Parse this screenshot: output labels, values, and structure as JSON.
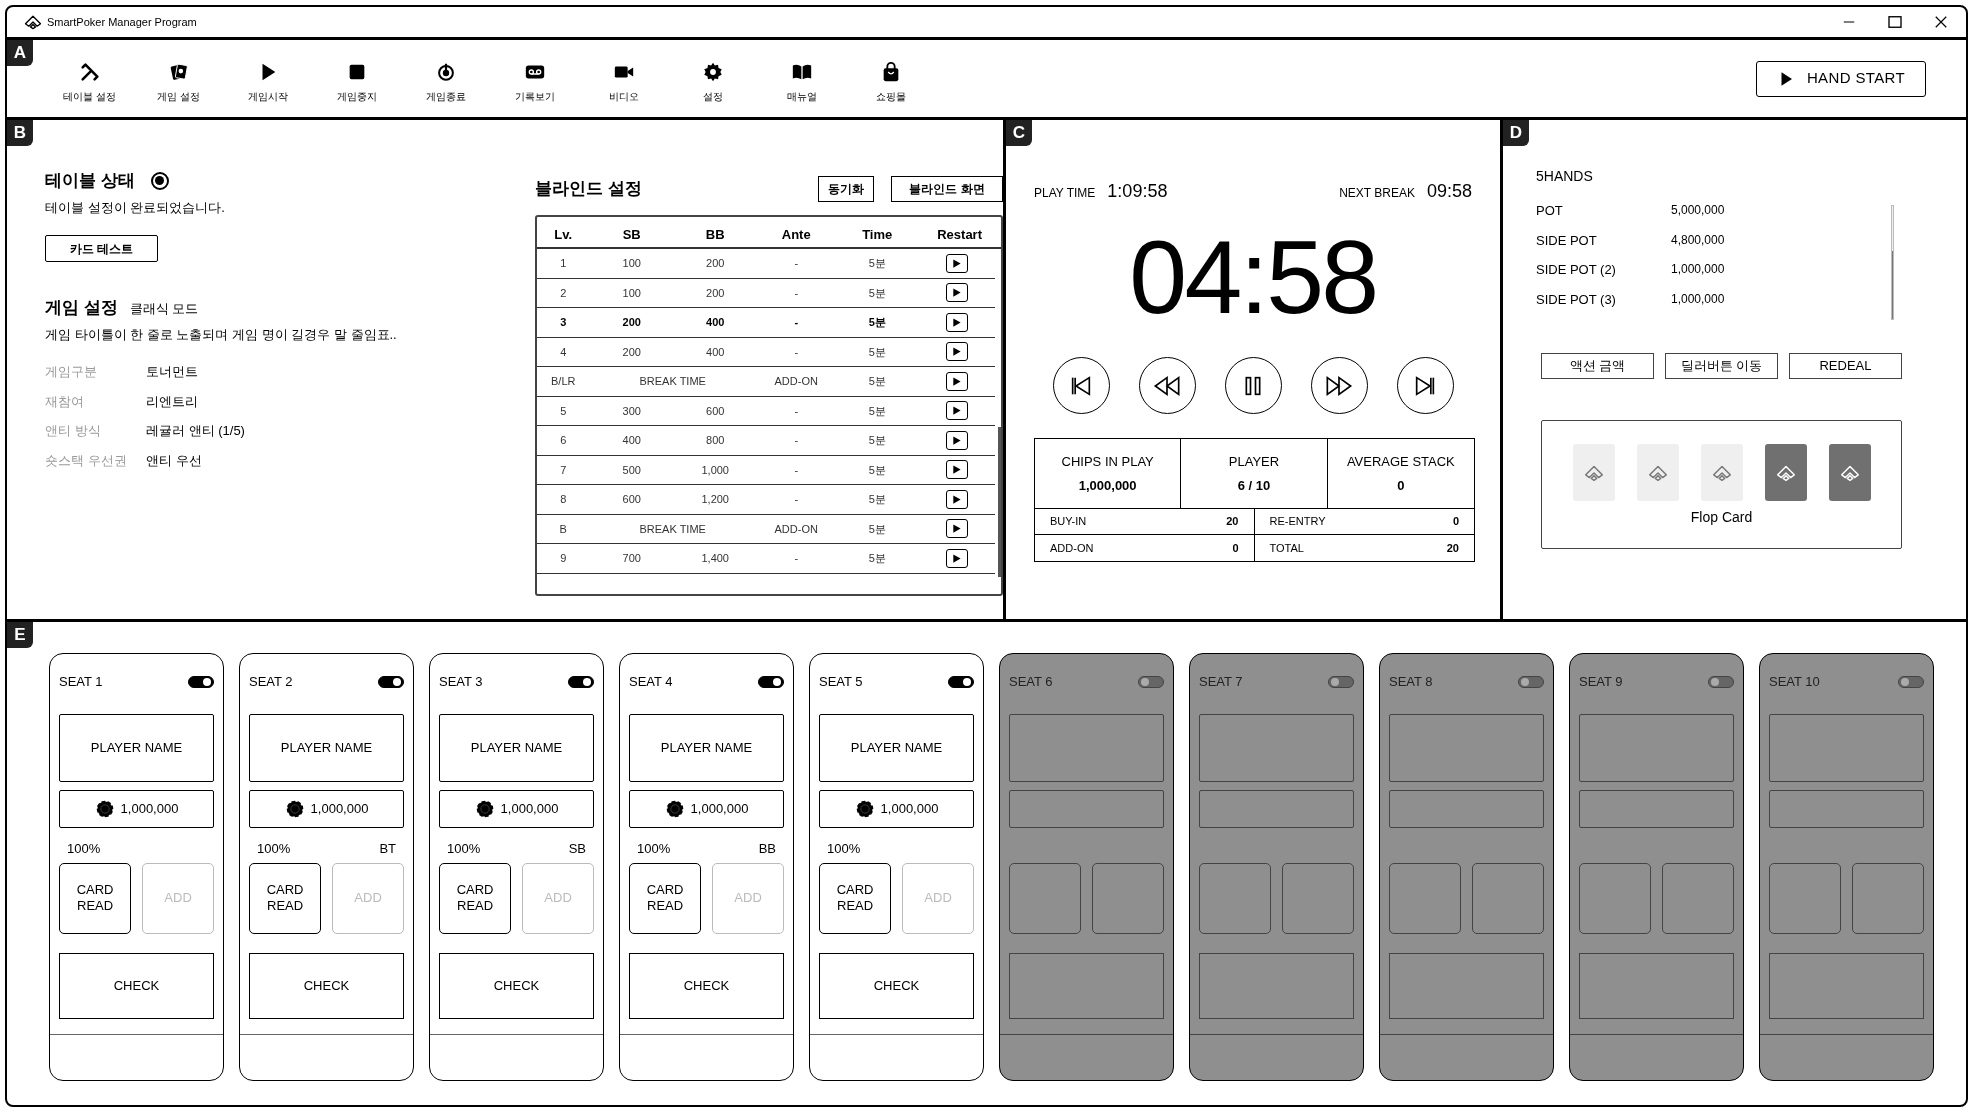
{
  "window": {
    "title": "SmartPoker Manager Program"
  },
  "toolbar": {
    "label": "A",
    "items": [
      {
        "label": "테이블 설정"
      },
      {
        "label": "게임 설정"
      },
      {
        "label": "게임시작"
      },
      {
        "label": "게임중지"
      },
      {
        "label": "게임종료"
      },
      {
        "label": "기록보기"
      },
      {
        "label": "비디오"
      },
      {
        "label": "설정"
      },
      {
        "label": "매뉴얼"
      },
      {
        "label": "쇼핑몰"
      }
    ],
    "hand_start": "HAND START"
  },
  "table_panel": {
    "label": "B",
    "table_status": {
      "title": "테이블 상태",
      "on": true,
      "message": "테이블 설정이 완료되었습니다.",
      "card_test": "카드 테스트"
    },
    "game_settings": {
      "title": "게임 설정",
      "mode": "클래식 모드",
      "description": "게임 타이틀이 한 줄로 노출되며 게임 명이 길경우 말 줄임표..",
      "fields": [
        {
          "label": "게임구분",
          "value": "토너먼트"
        },
        {
          "label": "재참여",
          "value": "리엔트리"
        },
        {
          "label": "앤티 방식",
          "value": "레귤러 앤티 (1/5)"
        },
        {
          "label": "숏스택 우선권",
          "value": "앤티 우선"
        }
      ]
    },
    "blinds": {
      "title": "블라인드 설정",
      "buttons": [
        "동기화",
        "블라인드 화면"
      ],
      "columns": [
        "Lv.",
        "SB",
        "BB",
        "Ante",
        "Time",
        "Restart"
      ],
      "rows": [
        {
          "kind": "level",
          "current": false,
          "cells": [
            "1",
            "100",
            "200",
            "-",
            "5분"
          ]
        },
        {
          "kind": "level",
          "current": false,
          "cells": [
            "2",
            "100",
            "200",
            "-",
            "5분"
          ]
        },
        {
          "kind": "level",
          "current": true,
          "cells": [
            "3",
            "200",
            "400",
            "-",
            "5분"
          ]
        },
        {
          "kind": "level",
          "current": false,
          "cells": [
            "4",
            "200",
            "400",
            "-",
            "5분"
          ]
        },
        {
          "kind": "break",
          "current": false,
          "cells": [
            "B/LR",
            "BREAK TIME",
            "",
            "ADD-ON",
            "5분"
          ]
        },
        {
          "kind": "level",
          "current": false,
          "cells": [
            "5",
            "300",
            "600",
            "-",
            "5분"
          ]
        },
        {
          "kind": "level",
          "current": false,
          "cells": [
            "6",
            "400",
            "800",
            "-",
            "5분"
          ]
        },
        {
          "kind": "level",
          "current": false,
          "cells": [
            "7",
            "500",
            "1,000",
            "-",
            "5분"
          ]
        },
        {
          "kind": "level",
          "current": false,
          "cells": [
            "8",
            "600",
            "1,200",
            "-",
            "5분"
          ]
        },
        {
          "kind": "break",
          "current": false,
          "cells": [
            "B",
            "BREAK TIME",
            "",
            "ADD-ON",
            "5분"
          ]
        },
        {
          "kind": "level",
          "current": false,
          "cells": [
            "9",
            "700",
            "1,400",
            "-",
            "5분"
          ]
        }
      ]
    }
  },
  "clock_panel": {
    "label": "C",
    "play_time_label": "PLAY TIME",
    "play_time": "1:09:58",
    "next_break_label": "NEXT BREAK",
    "next_break": "09:58",
    "clock": "04:58",
    "stats": [
      {
        "label": "CHIPS IN PLAY",
        "value": "1,000,000"
      },
      {
        "label": "PLAYER",
        "value": "6 / 10"
      },
      {
        "label": "AVERAGE STACK",
        "value": "0"
      }
    ],
    "counts": [
      {
        "label": "BUY-IN",
        "value": "20"
      },
      {
        "label": "RE-ENTRY",
        "value": "0"
      },
      {
        "label": "ADD-ON",
        "value": "0"
      },
      {
        "label": "TOTAL",
        "value": "20"
      }
    ]
  },
  "pot_panel": {
    "label": "D",
    "title": "5HANDS",
    "pots": [
      {
        "label": "POT",
        "value": "5,000,000"
      },
      {
        "label": "SIDE POT",
        "value": "4,800,000"
      },
      {
        "label": "SIDE POT (2)",
        "value": "1,000,000"
      },
      {
        "label": "SIDE POT (3)",
        "value": "1,000,000"
      }
    ],
    "buttons": [
      "액션 금액",
      "딜러버튼 이동",
      "REDEAL"
    ],
    "flop": {
      "label": "Flop Card",
      "cards": [
        {
          "highlighted": false
        },
        {
          "highlighted": false
        },
        {
          "highlighted": false
        },
        {
          "highlighted": true
        },
        {
          "highlighted": true
        }
      ]
    }
  },
  "seats_panel": {
    "label": "E",
    "seats": [
      {
        "label": "SEAT 1",
        "on": true,
        "player_name": "PLAYER NAME",
        "chips": "1,000,000",
        "percent": "100%",
        "card_read": "CARD READ",
        "add": "ADD",
        "check": "CHECK"
      },
      {
        "label": "SEAT 2",
        "on": true,
        "player_name": "PLAYER NAME",
        "chips": "1,000,000",
        "percent": "100%",
        "position": "BT",
        "card_read": "CARD READ",
        "add": "ADD",
        "check": "CHECK"
      },
      {
        "label": "SEAT 3",
        "on": true,
        "player_name": "PLAYER NAME",
        "chips": "1,000,000",
        "percent": "100%",
        "position": "SB",
        "card_read": "CARD READ",
        "add": "ADD",
        "check": "CHECK"
      },
      {
        "label": "SEAT 4",
        "on": true,
        "player_name": "PLAYER NAME",
        "chips": "1,000,000",
        "percent": "100%",
        "position": "BB",
        "card_read": "CARD READ",
        "add": "ADD",
        "check": "CHECK"
      },
      {
        "label": "SEAT 5",
        "on": true,
        "player_name": "PLAYER NAME",
        "chips": "1,000,000",
        "percent": "100%",
        "card_read": "CARD READ",
        "add": "ADD",
        "check": "CHECK"
      },
      {
        "label": "SEAT 6",
        "on": false
      },
      {
        "label": "SEAT 7",
        "on": false
      },
      {
        "label": "SEAT 8",
        "on": false
      },
      {
        "label": "SEAT 9",
        "on": false
      },
      {
        "label": "SEAT 10",
        "on": false
      }
    ]
  }
}
